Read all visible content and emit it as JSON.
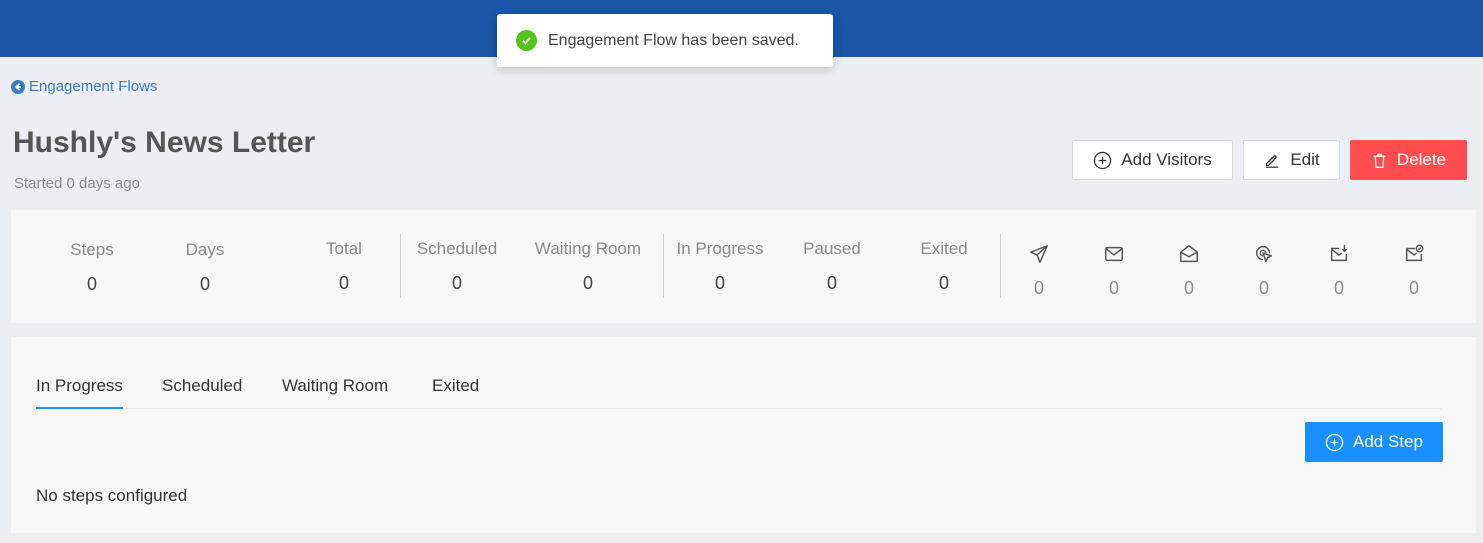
{
  "toast": {
    "message": "Engagement Flow has been saved.",
    "icon": "check-circle-icon"
  },
  "breadcrumb": {
    "label": "Engagement Flows"
  },
  "header": {
    "title": "Hushly's News Letter",
    "subtitle": "Started 0 days ago"
  },
  "actions": {
    "add_visitors": "Add Visitors",
    "edit": "Edit",
    "delete": "Delete"
  },
  "stats": {
    "steps": {
      "label": "Steps",
      "value": "0"
    },
    "days": {
      "label": "Days",
      "value": "0"
    },
    "total": {
      "label": "Total",
      "value": "0"
    },
    "scheduled": {
      "label": "Scheduled",
      "value": "0"
    },
    "waiting_room": {
      "label": "Waiting Room",
      "value": "0"
    },
    "in_progress": {
      "label": "In Progress",
      "value": "0"
    },
    "paused": {
      "label": "Paused",
      "value": "0"
    },
    "exited": {
      "label": "Exited",
      "value": "0"
    },
    "sent": {
      "icon": "send-icon",
      "value": "0"
    },
    "delivered": {
      "icon": "mail-icon",
      "value": "0"
    },
    "opened": {
      "icon": "mail-open-icon",
      "value": "0"
    },
    "clicked": {
      "icon": "click-icon",
      "value": "0"
    },
    "received": {
      "icon": "mail-download-icon",
      "value": "0"
    },
    "converted": {
      "icon": "mail-check-icon",
      "value": "0"
    }
  },
  "tabs": [
    {
      "label": "In Progress",
      "active": true
    },
    {
      "label": "Scheduled"
    },
    {
      "label": "Waiting Room"
    },
    {
      "label": "Exited"
    }
  ],
  "panel": {
    "add_step": "Add Step",
    "empty_message": "No steps configured"
  },
  "colors": {
    "topbar": "#1b56a8",
    "primary": "#1890ff",
    "danger": "#ff4d4f",
    "success": "#52c41a"
  }
}
